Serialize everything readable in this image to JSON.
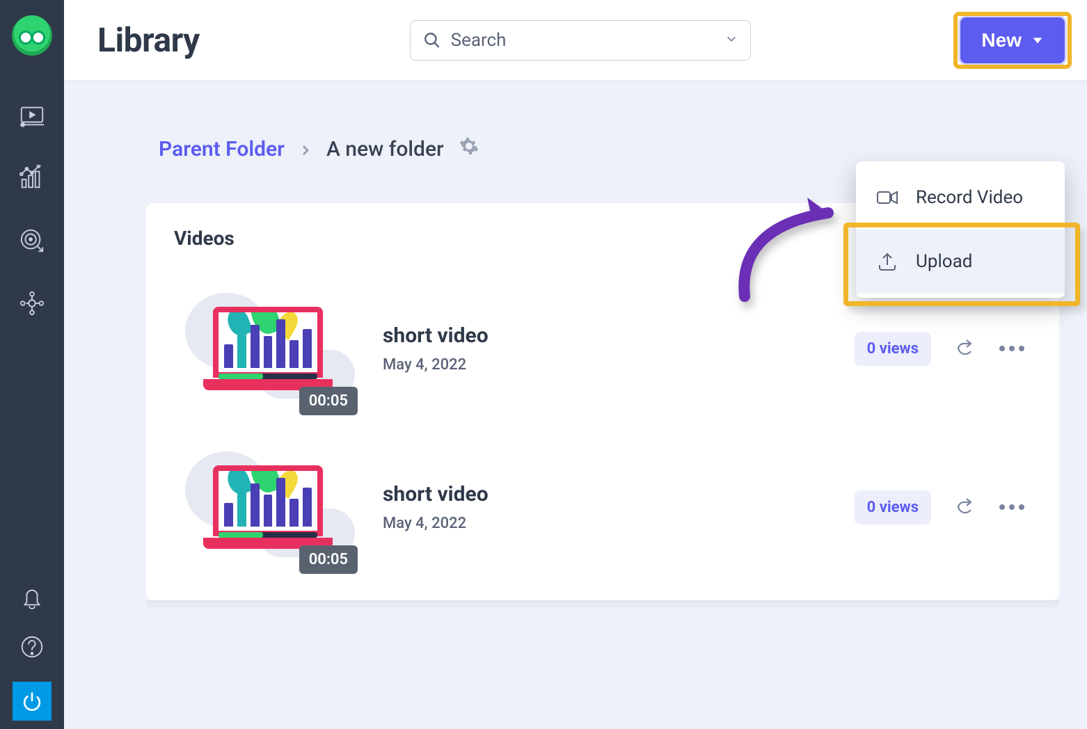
{
  "header": {
    "title": "Library",
    "search_placeholder": "Search",
    "new_button": "New"
  },
  "dropdown": {
    "record_label": "Record Video",
    "upload_label": "Upload"
  },
  "breadcrumb": {
    "parent": "Parent Folder",
    "current": "A new folder"
  },
  "section": {
    "title": "Videos"
  },
  "videos": [
    {
      "title": "short video",
      "date": "May 4, 2022",
      "duration": "00:05",
      "views": "0 views"
    },
    {
      "title": "short video",
      "date": "May 4, 2022",
      "duration": "00:05",
      "views": "0 views"
    }
  ]
}
